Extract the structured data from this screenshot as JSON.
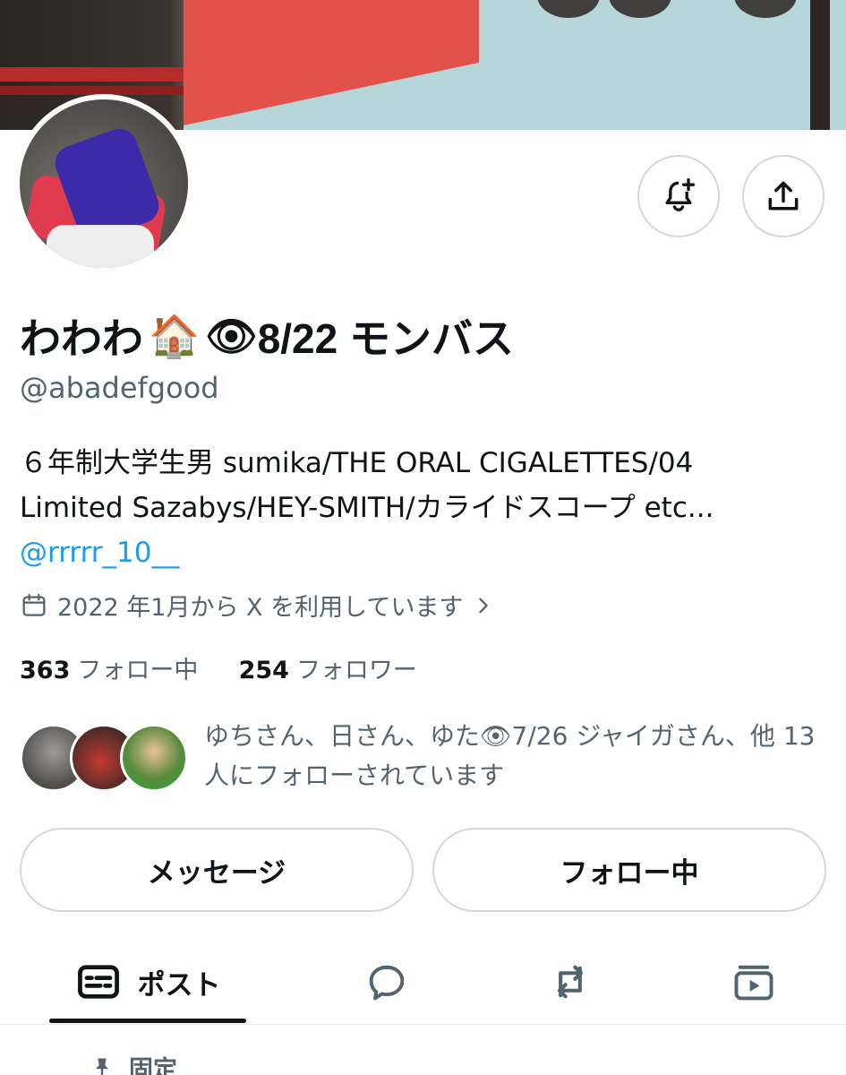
{
  "profile": {
    "display_name": "わわわ",
    "name_emoji_house": "🏠",
    "name_emoji_eye": "👁",
    "name_suffix": "8/22 モンバス",
    "handle": "@abadefgood",
    "bio_line1": "６年制大学生男 sumika/THE ORAL CIGALETTES/04",
    "bio_line2": "Limited Sazabys/HEY-SMITH/カライドスコープ etc...",
    "bio_mention": "@rrrrr_10__",
    "joined": "2022 年1月から X を利用しています",
    "following_count": "363",
    "following_label": "フォロー中",
    "followers_count": "254",
    "followers_label": "フォロワー",
    "known_followers_text": "ゆちさん、日さん、ゆた👁7/26 ジャイガさん、他 13 人にフォローされています"
  },
  "actions": {
    "message_label": "メッセージ",
    "following_button_label": "フォロー中"
  },
  "tabs": {
    "posts_label": "ポスト"
  },
  "pinned": {
    "label": "固定"
  },
  "icons": {
    "notify": "bell-plus-icon",
    "share": "share-icon",
    "calendar": "calendar-icon",
    "chevron": "chevron-right-icon",
    "posts": "posts-icon",
    "replies": "reply-bubble-icon",
    "reposts": "repost-icon",
    "media": "media-icon",
    "pin": "pin-icon"
  },
  "colors": {
    "text_primary": "#0f1419",
    "text_secondary": "#536471",
    "link": "#1d9bf0",
    "border": "#cfd9de"
  }
}
